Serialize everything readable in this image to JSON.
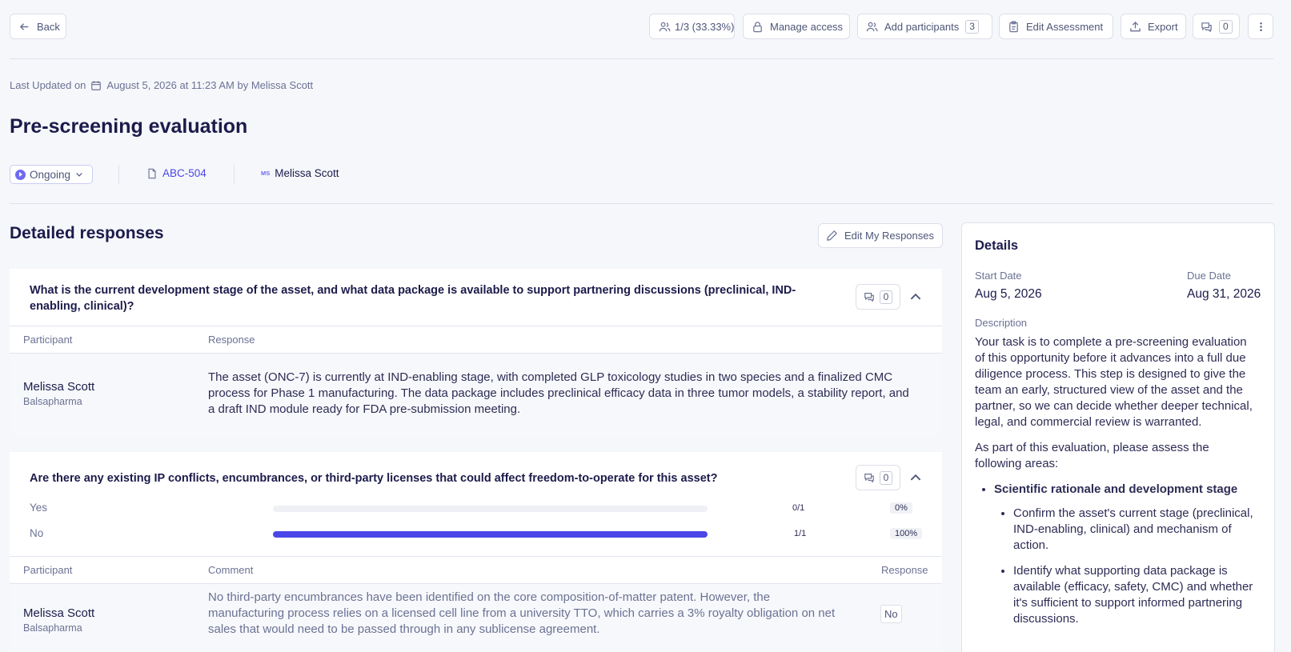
{
  "header": {
    "back_label": "Back",
    "progress_label": "1/3 (33.33%)",
    "manage_access_label": "Manage access",
    "add_participants_label": "Add participants",
    "add_participants_count": "3",
    "edit_assessment_label": "Edit Assessment",
    "export_label": "Export",
    "comments_count": "0"
  },
  "meta": {
    "last_updated_prefix": "Last Updated on",
    "last_updated_value": "August 5, 2026 at 11:23 AM by Melissa Scott",
    "title": "Pre-screening evaluation",
    "status": "Ongoing",
    "asset_code": "ABC-504",
    "owner_initials": "MS",
    "owner_name": "Melissa Scott"
  },
  "responses": {
    "heading": "Detailed responses",
    "edit_label": "Edit My Responses",
    "q1": {
      "text": "What is the current development stage of the asset, and what data package is available to support partnering discussions (preclinical, IND-enabling, clinical)?",
      "comment_count": "0",
      "col_participant": "Participant",
      "col_response": "Response",
      "participant_name": "Melissa Scott",
      "participant_org": "Balsapharma",
      "response": "The asset (ONC-7) is currently at IND-enabling stage, with completed GLP toxicology studies in two species and a finalized CMC process for Phase 1 manufacturing. The data package includes preclinical efficacy data in three tumor models, a stability report, and a draft IND module ready for FDA pre-submission meeting."
    },
    "q2": {
      "text": "Are there any existing IP conflicts, encumbrances, or third-party licenses that could affect freedom-to-operate for this asset?",
      "comment_count": "0",
      "options": [
        {
          "label": "Yes",
          "count": "0/1",
          "percent": "0%",
          "fraction": 0
        },
        {
          "label": "No",
          "count": "1/1",
          "percent": "100%",
          "fraction": 1
        }
      ],
      "col_participant": "Participant",
      "col_comment": "Comment",
      "col_response": "Response",
      "participant_name": "Melissa Scott",
      "participant_org": "Balsapharma",
      "comment": "No third-party encumbrances have been identified on the core composition-of-matter patent. However, the manufacturing process relies on a licensed cell line from a university TTO, which carries a 3% royalty obligation on net sales that would need to be passed through in any sublicense agreement.",
      "response": "No"
    }
  },
  "details": {
    "heading": "Details",
    "start_label": "Start Date",
    "start_value": "Aug 5, 2026",
    "due_label": "Due Date",
    "due_value": "Aug 31, 2026",
    "description_label": "Description",
    "description_p1": "Your task is to complete a pre-screening evaluation of this opportunity before it advances into a full due diligence process. This step is designed to give the team an early, structured view of the asset and the partner, so we can decide whether deeper technical, legal, and commercial review is warranted.",
    "description_p2": "As part of this evaluation, please assess the following areas:",
    "area1_title": "Scientific rationale and development stage",
    "area1_item1": "Confirm the asset's current stage (preclinical, IND-enabling, clinical) and mechanism of action.",
    "area1_item2": "Identify what supporting data package is available (efficacy, safety, CMC) and whether it's sufficient to support informed partnering discussions."
  },
  "colors": {
    "accent": "#4a46e8",
    "progress_flag": "#d32f2f",
    "title": "#1c1b4b"
  }
}
